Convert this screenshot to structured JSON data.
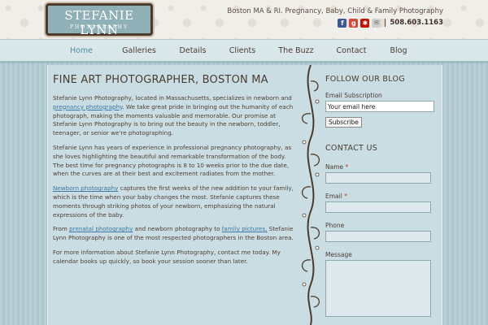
{
  "header": {
    "logo_name": "STEFANIE LYNN",
    "logo_sub": "PHOTOGRAPHY",
    "tagline": "Boston MA & RI. Pregnancy, Baby, Child & Family Photography",
    "phone": "508.603.1163",
    "social_icons": [
      "facebook-icon",
      "google-plus-icon",
      "yelp-icon",
      "email-icon"
    ]
  },
  "nav": {
    "items": [
      "Home",
      "Galleries",
      "Details",
      "Clients",
      "The Buzz",
      "Contact",
      "Blog"
    ],
    "active": "Home"
  },
  "main": {
    "title": "FINE ART PHOTOGRAPHER, BOSTON MA",
    "p1_a": "Stefanie Lynn Photography, located in Massachusetts, specializes in newborn and ",
    "p1_link": "pregnancy photography",
    "p1_b": ". We take great pride in bringing out the humanity of each photograph, making the moments valuable and memorable. Our promise at Stefanie Lynn Photography is to bring out the beauty in the newborn, toddler, teenager, or senior we're photographing.",
    "p2": "Stefanie Lynn has years of experience in professional pregnancy photography, as she loves highlighting the beautiful and remarkable transformation of the body. The best time for pregnancy photographs is 8 to 10 weeks prior to the due date, when the curves are at their best and excitement radiates from the mother.",
    "p3_link": "Newborn photography",
    "p3_b": " captures the first weeks of the new addition to your family, which is the time when your baby changes the most. Stefanie captures these moments through striking photos of your newborn, emphasizing the natural expressions of the baby.",
    "p4_a": "From ",
    "p4_link1": "prenatal photography",
    "p4_b": " and newborn photography to ",
    "p4_link2": "family pictures,",
    "p4_c": " Stefanie Lynn Photography is one of the most respected photographers in the Boston area.",
    "p5": "For more information about Stefanie Lynn Photography, contact me today. My calendar books up quickly, so book your session sooner than later."
  },
  "sidebar": {
    "follow_title": "FOLLOW OUR BLOG",
    "email_sub_label": "Email Subscription",
    "email_value": "Your email here",
    "subscribe_label": "Subscribe",
    "contact_title": "CONTACT US",
    "name_label": "Name",
    "email_label": "Email",
    "phone_label": "Phone",
    "message_label": "Message",
    "required_mark": "*"
  },
  "colors": {
    "accent": "#4f8ea2",
    "link": "#3c78a3",
    "text": "#4a3d33",
    "panel": "#c9dde2",
    "stripes": "#aec7ce"
  }
}
